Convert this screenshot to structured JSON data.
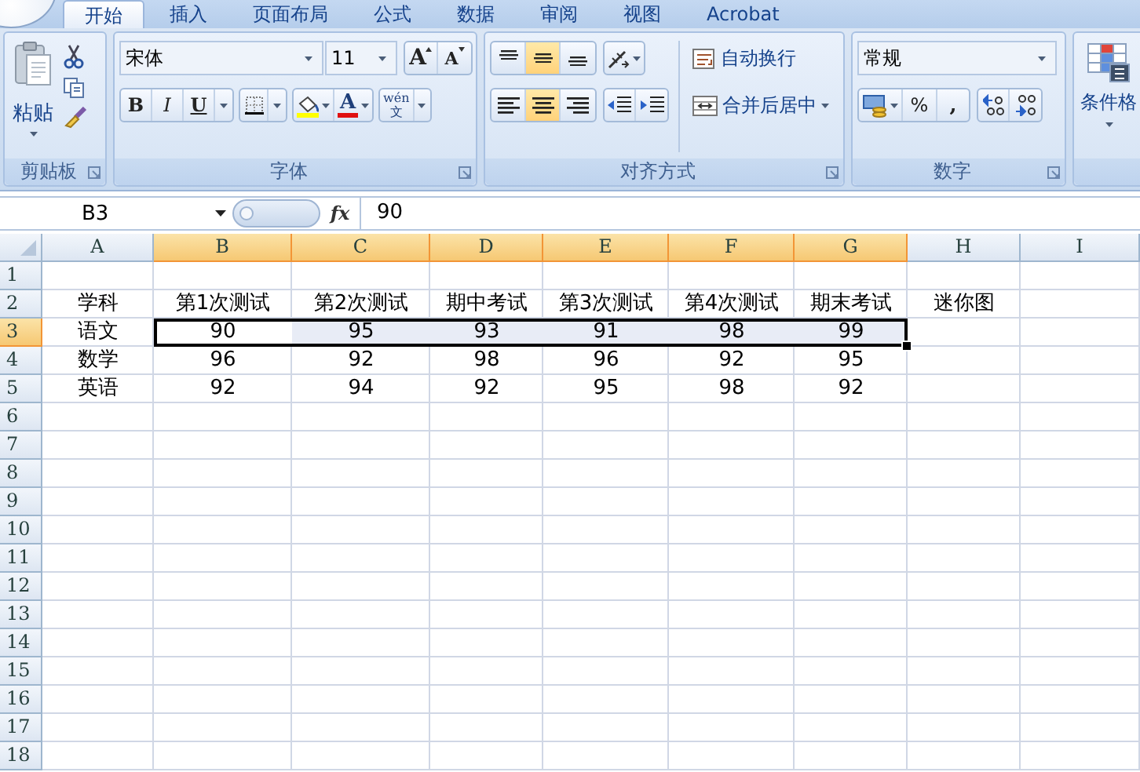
{
  "tabs": [
    {
      "label": "开始",
      "selected": true
    },
    {
      "label": "插入",
      "selected": false
    },
    {
      "label": "页面布局",
      "selected": false
    },
    {
      "label": "公式",
      "selected": false
    },
    {
      "label": "数据",
      "selected": false
    },
    {
      "label": "审阅",
      "selected": false
    },
    {
      "label": "视图",
      "selected": false
    },
    {
      "label": "Acrobat",
      "selected": false
    }
  ],
  "ribbon": {
    "clipboard": {
      "label": "剪贴板",
      "paste": "粘贴"
    },
    "font": {
      "label": "字体",
      "font_name": "宋体",
      "font_size": "11",
      "size_buttons": [
        {
          "kind": "grow",
          "label": "A"
        },
        {
          "kind": "shrink",
          "label": "A"
        }
      ],
      "style_buttons": [
        {
          "kind": "bold",
          "label": "B"
        },
        {
          "kind": "italic",
          "label": "I"
        },
        {
          "kind": "underline",
          "label": "U"
        }
      ],
      "font_color": "A",
      "phonetic": {
        "top": "wén",
        "bottom": "文"
      }
    },
    "alignment": {
      "label": "对齐方式",
      "vertical": [
        {
          "kind": "top",
          "selected": false
        },
        {
          "kind": "middle",
          "selected": true
        },
        {
          "kind": "bottom",
          "selected": false
        }
      ],
      "horizontal": [
        {
          "kind": "left",
          "selected": false
        },
        {
          "kind": "center",
          "selected": true
        },
        {
          "kind": "right",
          "selected": false
        }
      ],
      "wrap_text": "自动换行",
      "merge": "合并后居中"
    },
    "number": {
      "label": "数字",
      "format": "常规",
      "percent": "%",
      "comma": ","
    },
    "styles": {
      "conditional_format": "条件格"
    }
  },
  "formula_bar": {
    "cell": "B3",
    "fx": "fx",
    "value": "90"
  },
  "sheet": {
    "columns": [
      {
        "label": "A",
        "selected": false
      },
      {
        "label": "B",
        "selected": true
      },
      {
        "label": "C",
        "selected": true
      },
      {
        "label": "D",
        "selected": true
      },
      {
        "label": "E",
        "selected": true
      },
      {
        "label": "F",
        "selected": true
      },
      {
        "label": "G",
        "selected": true
      },
      {
        "label": "H",
        "selected": false
      },
      {
        "label": "I",
        "selected": false
      }
    ],
    "rows": [
      {
        "label": "1",
        "selected": false
      },
      {
        "label": "2",
        "selected": false,
        "cells": [
          "学科",
          "第1次测试",
          "第2次测试",
          "期中考试",
          "第3次测试",
          "第4次测试",
          "期末考试",
          "迷你图"
        ]
      },
      {
        "label": "3",
        "selected": true,
        "cells": [
          "语文",
          "90",
          "95",
          "93",
          "91",
          "98",
          "99"
        ]
      },
      {
        "label": "4",
        "selected": false,
        "cells": [
          "数学",
          "96",
          "92",
          "98",
          "96",
          "92",
          "95"
        ]
      },
      {
        "label": "5",
        "selected": false,
        "cells": [
          "英语",
          "92",
          "94",
          "92",
          "95",
          "98",
          "92"
        ]
      },
      {
        "label": "6",
        "selected": false
      },
      {
        "label": "7",
        "selected": false
      },
      {
        "label": "8",
        "selected": false
      },
      {
        "label": "9",
        "selected": false
      },
      {
        "label": "10",
        "selected": false
      },
      {
        "label": "11",
        "selected": false
      },
      {
        "label": "12",
        "selected": false
      },
      {
        "label": "13",
        "selected": false
      },
      {
        "label": "14",
        "selected": false
      },
      {
        "label": "15",
        "selected": false
      },
      {
        "label": "16",
        "selected": false
      },
      {
        "label": "17",
        "selected": false
      },
      {
        "label": "18",
        "selected": false
      }
    ]
  }
}
